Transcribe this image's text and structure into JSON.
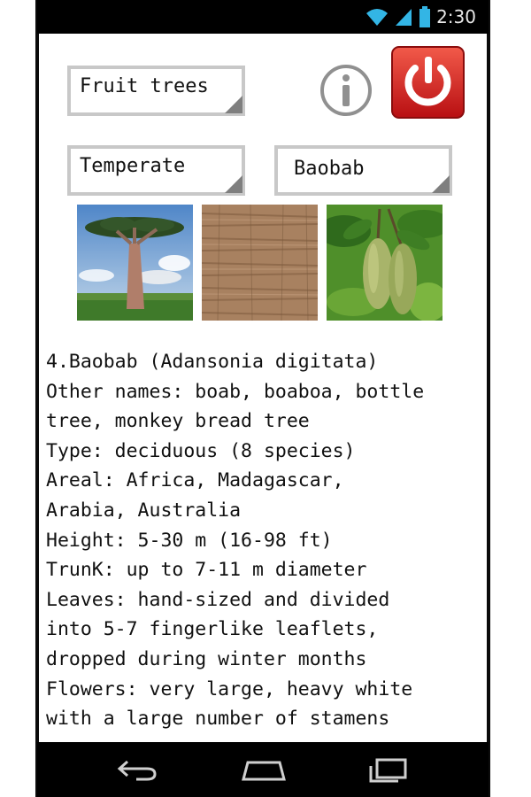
{
  "status_bar": {
    "time": "2:30",
    "icons": [
      "wifi-icon",
      "signal-icon",
      "battery-icon"
    ]
  },
  "toolbar": {
    "category_spinner": "Fruit trees",
    "info_icon": "info-icon",
    "power_icon": "power-icon"
  },
  "filters": {
    "climate_spinner": "Temperate",
    "tree_spinner": "Baobab"
  },
  "images": [
    "baobab-tree-photo",
    "baobab-bark-photo",
    "baobab-fruit-photo"
  ],
  "info": {
    "lines": [
      "4.Baobab (Adansonia digitata)",
      "Other names: boab, boaboa, bottle",
      "tree, monkey bread tree",
      "Type: deciduous (8 species)",
      "Areal: Africa, Madagascar,",
      "Arabia, Australia",
      "Height: 5-30 m (16-98 ft)",
      "TrunK: up to 7-11 m diameter",
      "Leaves: hand-sized and divided",
      "into 5-7 fingerlike leaflets,",
      "dropped during winter months",
      "Flowers: very large, heavy white",
      "with a large number of stamens"
    ]
  },
  "nav_bar": [
    "back-icon",
    "home-icon",
    "recents-icon"
  ],
  "colors": {
    "status_bar": "#000000",
    "power_button": "#d41e1e",
    "spinner_border": "#c8c8c8"
  }
}
